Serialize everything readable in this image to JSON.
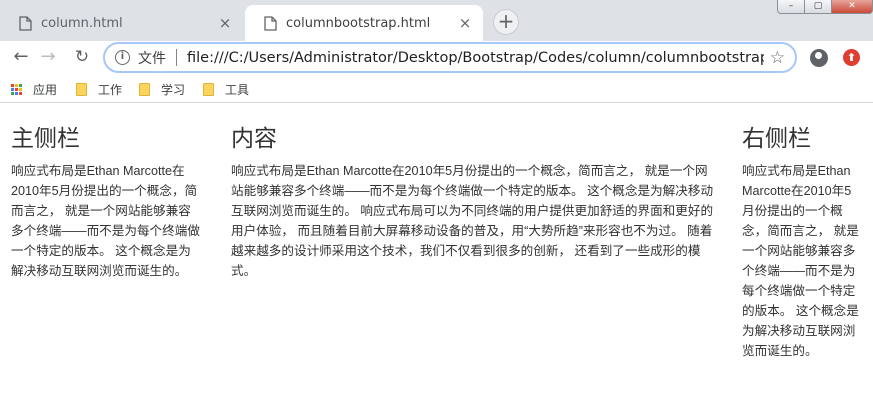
{
  "tabs": [
    {
      "title": "column.html",
      "close": "×"
    },
    {
      "title": "columnbootstrap.html",
      "close": "×"
    }
  ],
  "newtab_label": "+",
  "window": {
    "min": "–",
    "max": "▢",
    "close": "✕"
  },
  "toolbar": {
    "back": "←",
    "forward": "→",
    "reload": "↻",
    "file_label": "文件",
    "url": "file:///C:/Users/Administrator/Desktop/Bootstrap/Codes/column/columnbootstrap....",
    "star": "☆",
    "ext": "⬆"
  },
  "bookmarks": {
    "apps": "应用",
    "items": [
      "工作",
      "学习",
      "工具"
    ]
  },
  "icons": {
    "page": "page-icon",
    "info": "info-icon",
    "star": "star-icon",
    "profile": "profile-icon",
    "apps": "apps-grid-icon",
    "folder": "folder-icon"
  },
  "colors": {
    "tabstrip": "#dee1e6",
    "omnibox_border": "#a8c7fa",
    "text": "#333333"
  },
  "content": {
    "left": {
      "heading": "主侧栏",
      "text": "响应式布局是Ethan Marcotte在2010年5月份提出的一个概念，简而言之， 就是一个网站能够兼容多个终端——而不是为每个终端做一个特定的版本。 这个概念是为解决移动互联网浏览而诞生的。"
    },
    "main": {
      "heading": "内容",
      "text": "响应式布局是Ethan Marcotte在2010年5月份提出的一个概念，简而言之， 就是一个网站能够兼容多个终端——而不是为每个终端做一个特定的版本。 这个概念是为解决移动互联网浏览而诞生的。 响应式布局可以为不同终端的用户提供更加舒适的界面和更好的用户体验， 而且随着目前大屏幕移动设备的普及，用“大势所趋”来形容也不为过。 随着越来越多的设计师采用这个技术，我们不仅看到很多的创新， 还看到了一些成形的模式。"
    },
    "right": {
      "heading": "右侧栏",
      "text": "响应式布局是Ethan Marcotte在2010年5月份提出的一个概念，简而言之， 就是一个网站能够兼容多个终端——而不是为每个终端做一个特定的版本。 这个概念是为解决移动互联网浏览而诞生的。"
    }
  }
}
